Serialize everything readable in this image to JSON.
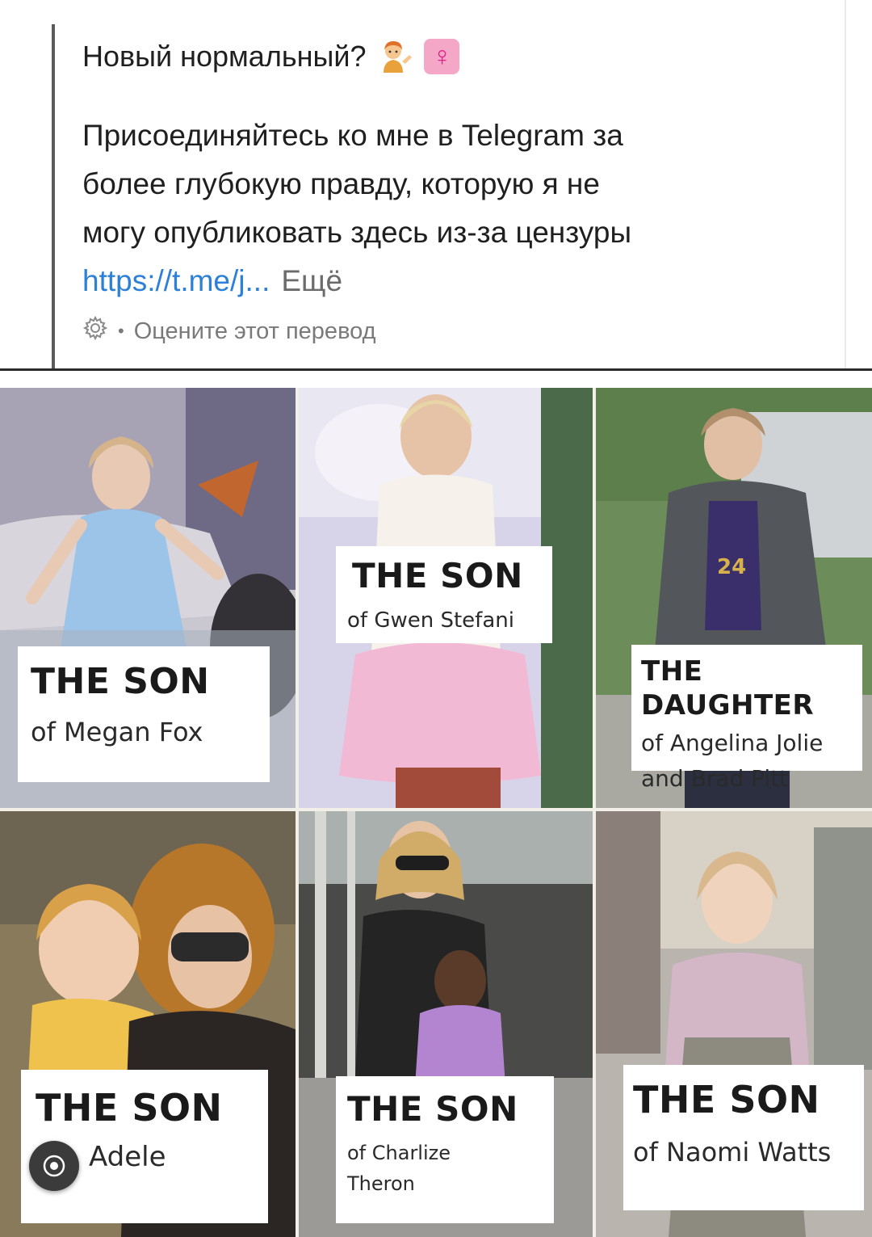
{
  "post": {
    "title": "Новый нормальный?",
    "emoji_person": "person-tipping-hand-icon",
    "emoji_female": "♀",
    "body": "Присоединяйтесь ко мне в Telegram за\nболее глубокую правду, которую я не\nмогу опубликовать здесь из-за цензуры",
    "link_text": "https://t.me/j...",
    "more_label": "Ещё",
    "rate_dot": "•",
    "rate_label": "Оцените этот перевод"
  },
  "meme": {
    "panels": [
      {
        "head": "THE SON",
        "sub": "of Megan Fox"
      },
      {
        "head": "THE SON",
        "sub": "of Gwen Stefani"
      },
      {
        "head": "THE DAUGHTER",
        "sub": "of Angelina Jolie\nand Brad Pitt"
      },
      {
        "head": "THE SON",
        "sub": "Adele"
      },
      {
        "head": "THE SON",
        "sub": "of Charlize\nTheron"
      },
      {
        "head": "THE SON",
        "sub": "of Naomi Watts"
      }
    ],
    "jersey_number": "24"
  },
  "colors": {
    "link": "#2d80d8",
    "quote_bar": "#5a5a5a",
    "badge_bg": "#f4a7c6",
    "badge_symbol": "#e0218a"
  }
}
